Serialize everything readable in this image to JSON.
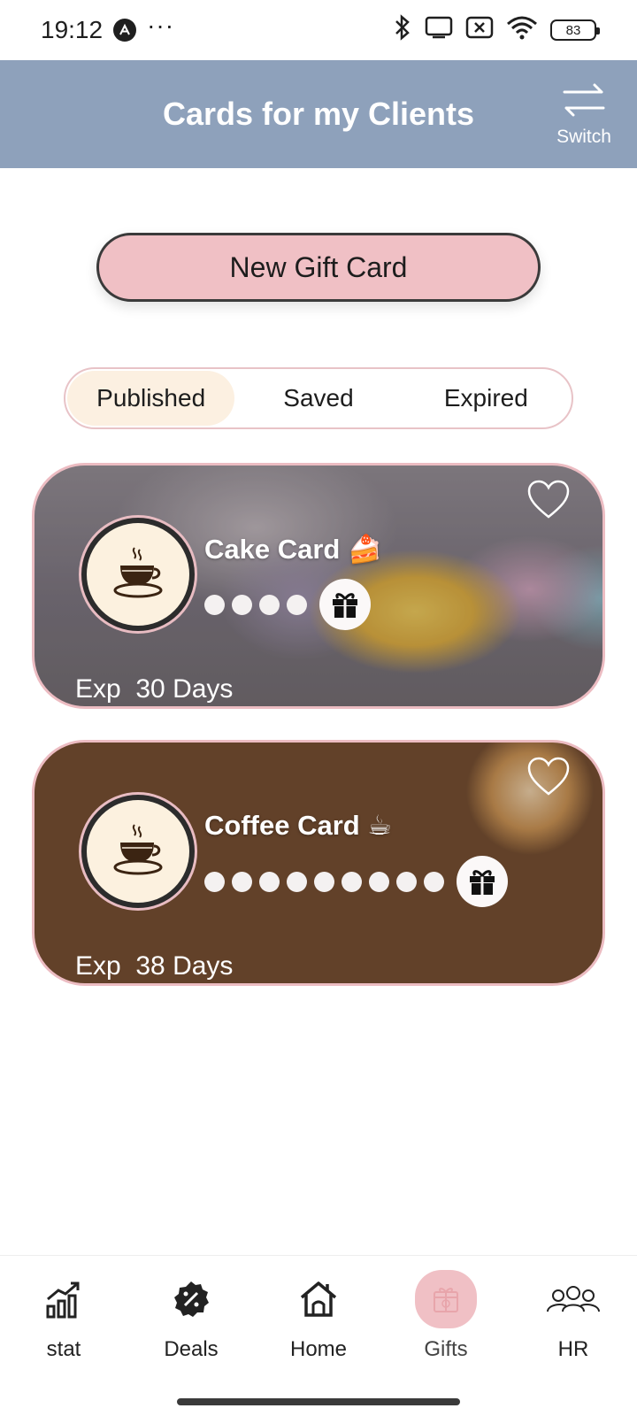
{
  "status_bar": {
    "time": "19:12",
    "more": "···",
    "battery": "83",
    "icons": [
      "app-notification-icon",
      "bluetooth-icon",
      "cast-icon",
      "sim-off-icon",
      "wifi-icon",
      "battery-icon"
    ]
  },
  "header": {
    "title": "Cards for my Clients",
    "switch_label": "Switch"
  },
  "new_gift_card_label": "New Gift Card",
  "tabs": [
    {
      "label": "Published",
      "active": true
    },
    {
      "label": "Saved",
      "active": false
    },
    {
      "label": "Expired",
      "active": false
    }
  ],
  "cards": [
    {
      "title": "Cake Card 🍰",
      "stamps": 4,
      "expiry": "Exp  30 Days",
      "favorited": false,
      "background": "cupcakes photo"
    },
    {
      "title": "Coffee Card ☕",
      "stamps": 9,
      "expiry": "Exp  38 Days",
      "favorited": false,
      "background": "coffee cups on wooden table photo"
    }
  ],
  "bottom_nav": [
    {
      "label": "stat",
      "icon": "stats-chart-icon",
      "active": false
    },
    {
      "label": "Deals",
      "icon": "discount-badge-icon",
      "active": false
    },
    {
      "label": "Home",
      "icon": "home-icon",
      "active": false
    },
    {
      "label": "Gifts",
      "icon": "gift-box-icon",
      "active": true
    },
    {
      "label": "HR",
      "icon": "people-group-icon",
      "active": false
    }
  ],
  "colors": {
    "header_bg": "#8ea1bb",
    "accent_pink": "#f0c0c5",
    "tab_active_bg": "#fcf0e1",
    "card_border": "#ecbcc2"
  }
}
